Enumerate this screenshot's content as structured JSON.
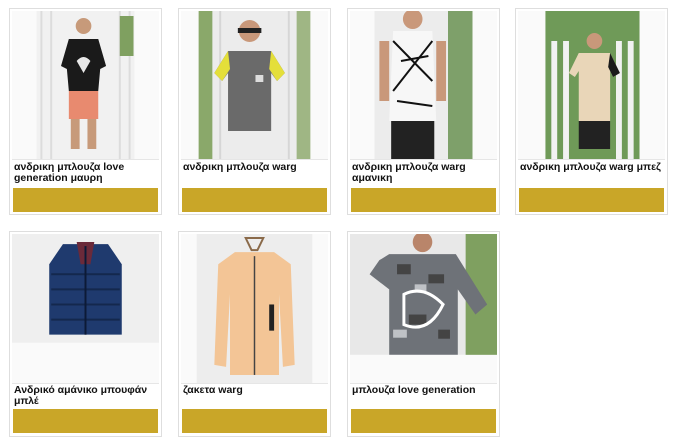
{
  "products": [
    {
      "title": "ανδρικη μπλουζα love generation μαυρη",
      "image": "black-tshirt-photo"
    },
    {
      "title": "ανδρικη μπλουζα warg",
      "image": "grey-yellow-tshirt-photo"
    },
    {
      "title": "ανδρικη μπλουζα warg αμανικη",
      "image": "white-tank-photo"
    },
    {
      "title": "ανδρικη μπλουζα warg μπεζ",
      "image": "beige-tshirt-photo"
    },
    {
      "title": "Ανδρικό αμάνικο μπουφάν μπλέ",
      "image": "blue-vest-photo"
    },
    {
      "title": "ζακετα warg",
      "image": "beige-jacket-photo"
    },
    {
      "title": "μπλουζα love generation",
      "image": "camo-tshirt-photo"
    }
  ],
  "colors": {
    "button": "#c9a628",
    "border": "#dedede"
  }
}
